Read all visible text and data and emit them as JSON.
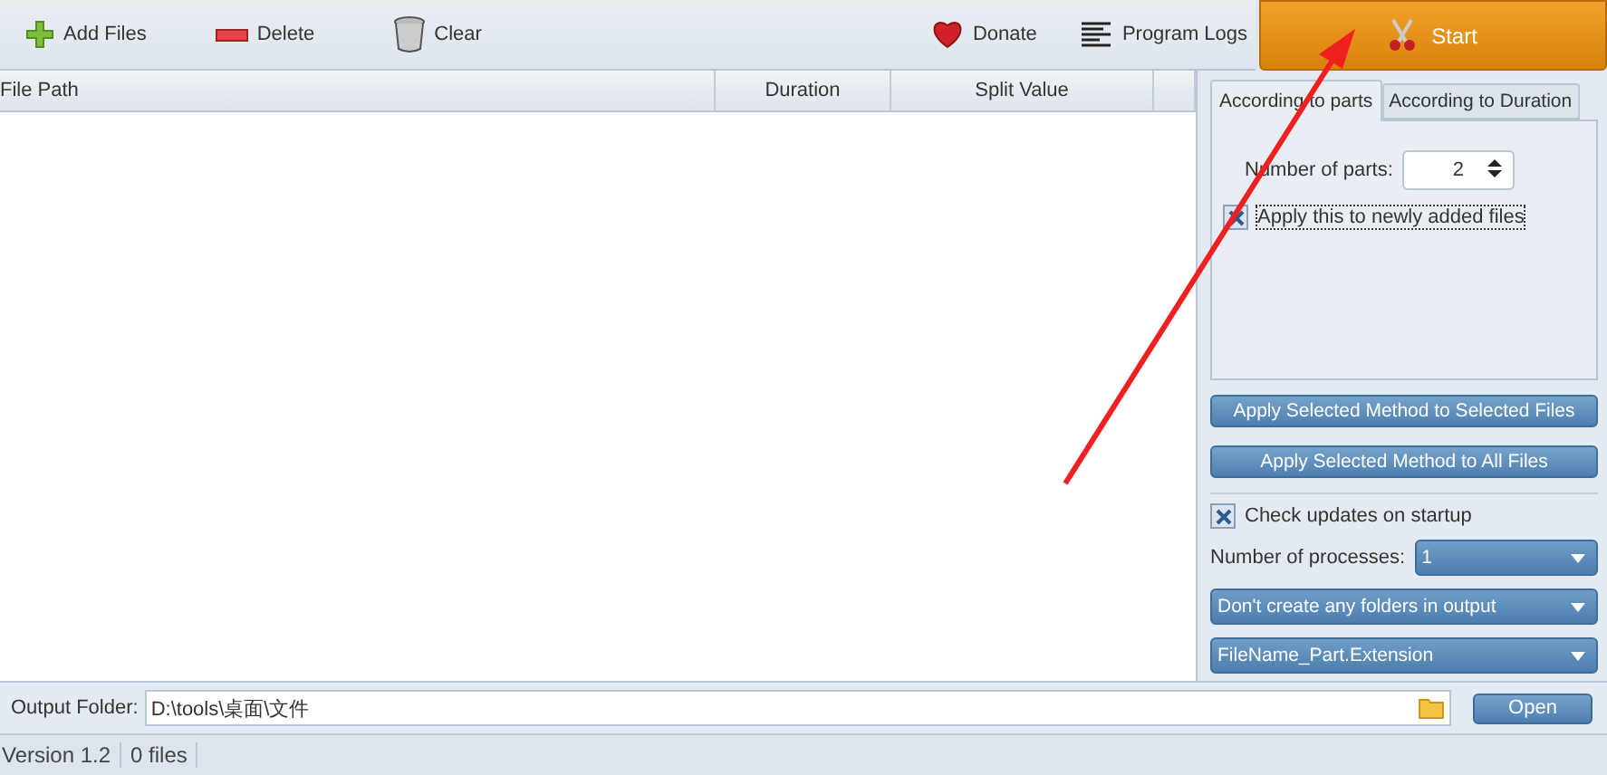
{
  "toolbar": [
    {
      "kind": "add",
      "label": "Add Files"
    },
    {
      "kind": "delete",
      "label": "Delete"
    },
    {
      "kind": "clear",
      "label": "Clear"
    },
    {
      "kind": "donate",
      "label": "Donate"
    },
    {
      "kind": "logs",
      "label": "Program Logs"
    }
  ],
  "start_button": {
    "label": "Start"
  },
  "table": {
    "columns": [
      "File Path",
      "Duration",
      "Split Value"
    ]
  },
  "tabs": [
    {
      "label": "According to parts",
      "selected": true
    },
    {
      "label": "According to Duration",
      "selected": false
    }
  ],
  "parts": {
    "label": "Number of parts:",
    "value": "2"
  },
  "apply_new": {
    "label": "Apply this to newly added files",
    "checked": true
  },
  "apply_buttons": [
    "Apply Selected Method to Selected Files",
    "Apply Selected Method to All Files"
  ],
  "check_updates": {
    "label": "Check updates on startup",
    "checked": true
  },
  "processes": {
    "label": "Number of processes:",
    "value": "1"
  },
  "folder_option": "Don't create any folders in output",
  "naming_option": "FileName_Part.Extension",
  "output": {
    "label": "Output Folder:",
    "value": "D:\\tools\\桌面\\文件",
    "button": "Open"
  },
  "status_bar": [
    "Version 1.2",
    "0 files"
  ]
}
